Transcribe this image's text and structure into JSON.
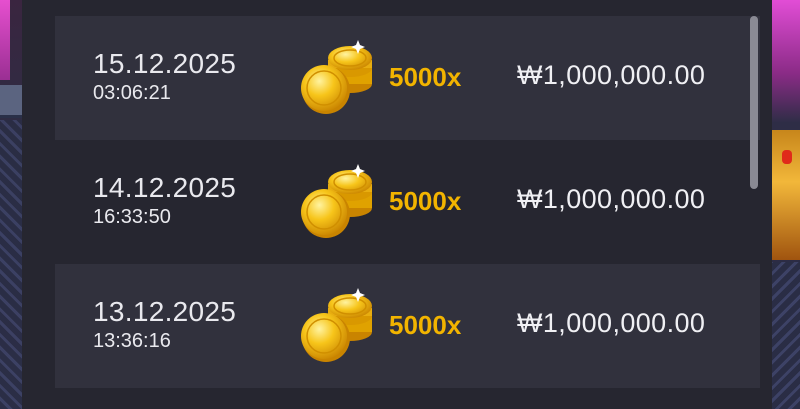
{
  "history": {
    "rows": [
      {
        "date": "15.12.2025",
        "time": "03:06:21",
        "multiplier": "5000x",
        "amount": "₩1,000,000.00",
        "shaded": true
      },
      {
        "date": "14.12.2025",
        "time": "16:33:50",
        "multiplier": "5000x",
        "amount": "₩1,000,000.00",
        "shaded": false
      },
      {
        "date": "13.12.2025",
        "time": "13:36:16",
        "multiplier": "5000x",
        "amount": "₩1,000,000.00",
        "shaded": true
      }
    ],
    "icon": "gold-coins-icon",
    "colors": {
      "multiplier": "#f2b400",
      "panel": "#262630",
      "row_shaded": "#31313d"
    }
  }
}
